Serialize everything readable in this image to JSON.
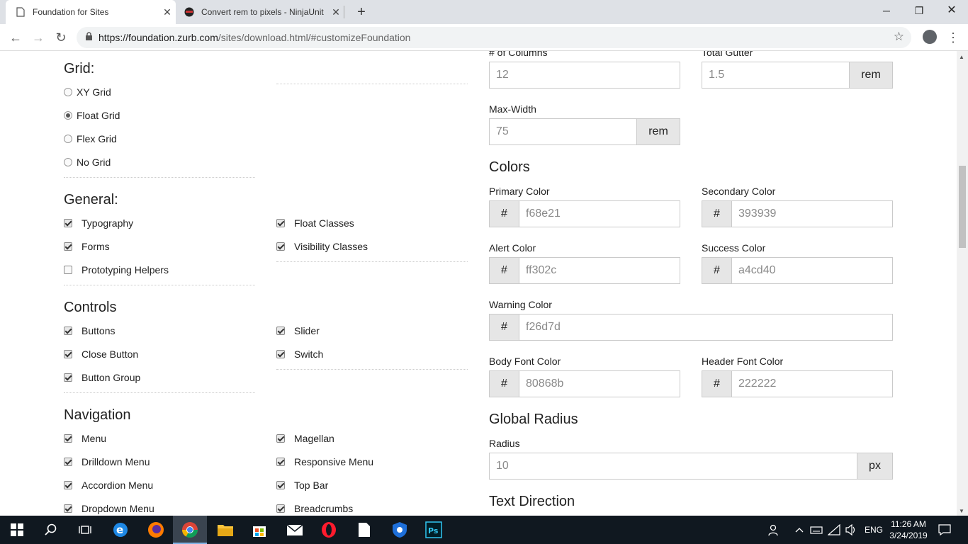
{
  "browser": {
    "tabs": [
      {
        "title": "Foundation for Sites",
        "active": true
      },
      {
        "title": "Convert rem to pixels - NinjaUnit",
        "active": false
      }
    ],
    "url_host": "https://foundation.zurb.com",
    "url_path": "/sites/download.html/#customizeFoundation"
  },
  "left": {
    "grid": {
      "heading": "Grid:",
      "options": [
        {
          "label": "XY Grid",
          "selected": false
        },
        {
          "label": "Float Grid",
          "selected": true
        },
        {
          "label": "Flex Grid",
          "selected": false
        },
        {
          "label": "No Grid",
          "selected": false
        }
      ]
    },
    "general": {
      "heading": "General:",
      "items": [
        {
          "label": "Typography",
          "checked": true
        },
        {
          "label": "Forms",
          "checked": true
        },
        {
          "label": "Prototyping Helpers",
          "checked": false
        },
        {
          "label": "Float Classes",
          "checked": true
        },
        {
          "label": "Visibility Classes",
          "checked": true
        }
      ]
    },
    "controls": {
      "heading": "Controls",
      "items": [
        {
          "label": "Buttons",
          "checked": true
        },
        {
          "label": "Close Button",
          "checked": true
        },
        {
          "label": "Button Group",
          "checked": true
        },
        {
          "label": "Slider",
          "checked": true
        },
        {
          "label": "Switch",
          "checked": true
        }
      ]
    },
    "navigation": {
      "heading": "Navigation",
      "items": [
        {
          "label": "Menu",
          "checked": true
        },
        {
          "label": "Drilldown Menu",
          "checked": true
        },
        {
          "label": "Accordion Menu",
          "checked": true
        },
        {
          "label": "Dropdown Menu",
          "checked": true
        },
        {
          "label": "Magellan",
          "checked": true
        },
        {
          "label": "Responsive Menu",
          "checked": true
        },
        {
          "label": "Top Bar",
          "checked": true
        },
        {
          "label": "Breadcrumbs",
          "checked": true
        }
      ]
    }
  },
  "right": {
    "columns": {
      "label": "# of Columns",
      "value": "12"
    },
    "gutter": {
      "label": "Total Gutter",
      "value": "1.5",
      "unit": "rem"
    },
    "maxwidth": {
      "label": "Max-Width",
      "value": "75",
      "unit": "rem"
    },
    "colors_heading": "Colors",
    "hash": "#",
    "primary": {
      "label": "Primary Color",
      "value": "f68e21"
    },
    "secondary": {
      "label": "Secondary Color",
      "value": "393939"
    },
    "alert": {
      "label": "Alert Color",
      "value": "ff302c"
    },
    "success": {
      "label": "Success Color",
      "value": "a4cd40"
    },
    "warning": {
      "label": "Warning Color",
      "value": "f26d7d"
    },
    "body_font": {
      "label": "Body Font Color",
      "value": "80868b"
    },
    "header_font": {
      "label": "Header Font Color",
      "value": "222222"
    },
    "radius_heading": "Global Radius",
    "radius": {
      "label": "Radius",
      "value": "10",
      "unit": "px"
    },
    "text_direction_heading": "Text Direction"
  },
  "taskbar": {
    "language": "ENG",
    "time": "11:26 AM",
    "date": "3/24/2019"
  }
}
